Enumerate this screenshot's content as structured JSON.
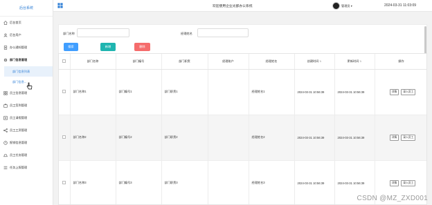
{
  "brand": "后台系统",
  "sidebar": {
    "items": [
      {
        "label": "后台首页",
        "icon": "home-icon"
      },
      {
        "label": "后台用户",
        "icon": "user-icon"
      },
      {
        "label": "办公通知管理",
        "icon": "document-icon"
      },
      {
        "label": "部门信息管理",
        "icon": "settings-icon",
        "open": true
      },
      {
        "label": "员工信息管理",
        "icon": "grid-icon"
      },
      {
        "label": "员工签到管理",
        "icon": "briefcase-icon"
      },
      {
        "label": "员工请假管理",
        "icon": "list-icon"
      },
      {
        "label": "员工工资管理",
        "icon": "share-icon"
      },
      {
        "label": "报销信息管理",
        "icon": "clock-icon"
      },
      {
        "label": "员工任务管理",
        "icon": "task-icon"
      },
      {
        "label": "任务上报管理",
        "icon": "menu-icon"
      }
    ],
    "sub_items": [
      "部门信息列表",
      "部门信息..."
    ]
  },
  "header": {
    "title": "欢迎使用企业光部办公系统",
    "user": "管理员 ▾",
    "datetime": "2024-03-31 11:03:09"
  },
  "search": {
    "dept_name_label": "部门名称",
    "manager_name_label": "经理姓名",
    "search_btn": "搜索",
    "add_btn": "新增",
    "delete_btn": "删除"
  },
  "table": {
    "headers": [
      "部门名称",
      "部门编号",
      "部门职责",
      "经理账户",
      "经理姓名",
      "创建时间",
      "更新时间",
      "操作"
    ],
    "rows": [
      {
        "name": "部门名称1",
        "code": "部门编号1",
        "duty": "部门职责1",
        "account": "",
        "manager": "经理姓名1",
        "created": "2024-03-31 10:56:39",
        "updated": "2024-03-31 10:56:39"
      },
      {
        "name": "部门名称2",
        "code": "部门编号2",
        "duty": "部门职责2",
        "account": "",
        "manager": "经理姓名2",
        "created": "2024-03-31 10:56:39",
        "updated": "2024-03-31 10:56:39"
      },
      {
        "name": "部门名称3",
        "code": "部门编号3",
        "duty": "部门职责3",
        "account": "",
        "manager": "经理姓名3",
        "created": "2024-03-31 10:56:39",
        "updated": "2024-03-31 10:56:39"
      }
    ],
    "op_detail": "详情",
    "op_import": "录入员工"
  },
  "watermark": "CSDN @MZ_ZXD001",
  "colors": {
    "primary": "#409eff",
    "success": "#1fb5b0",
    "danger": "#f56c6c"
  }
}
